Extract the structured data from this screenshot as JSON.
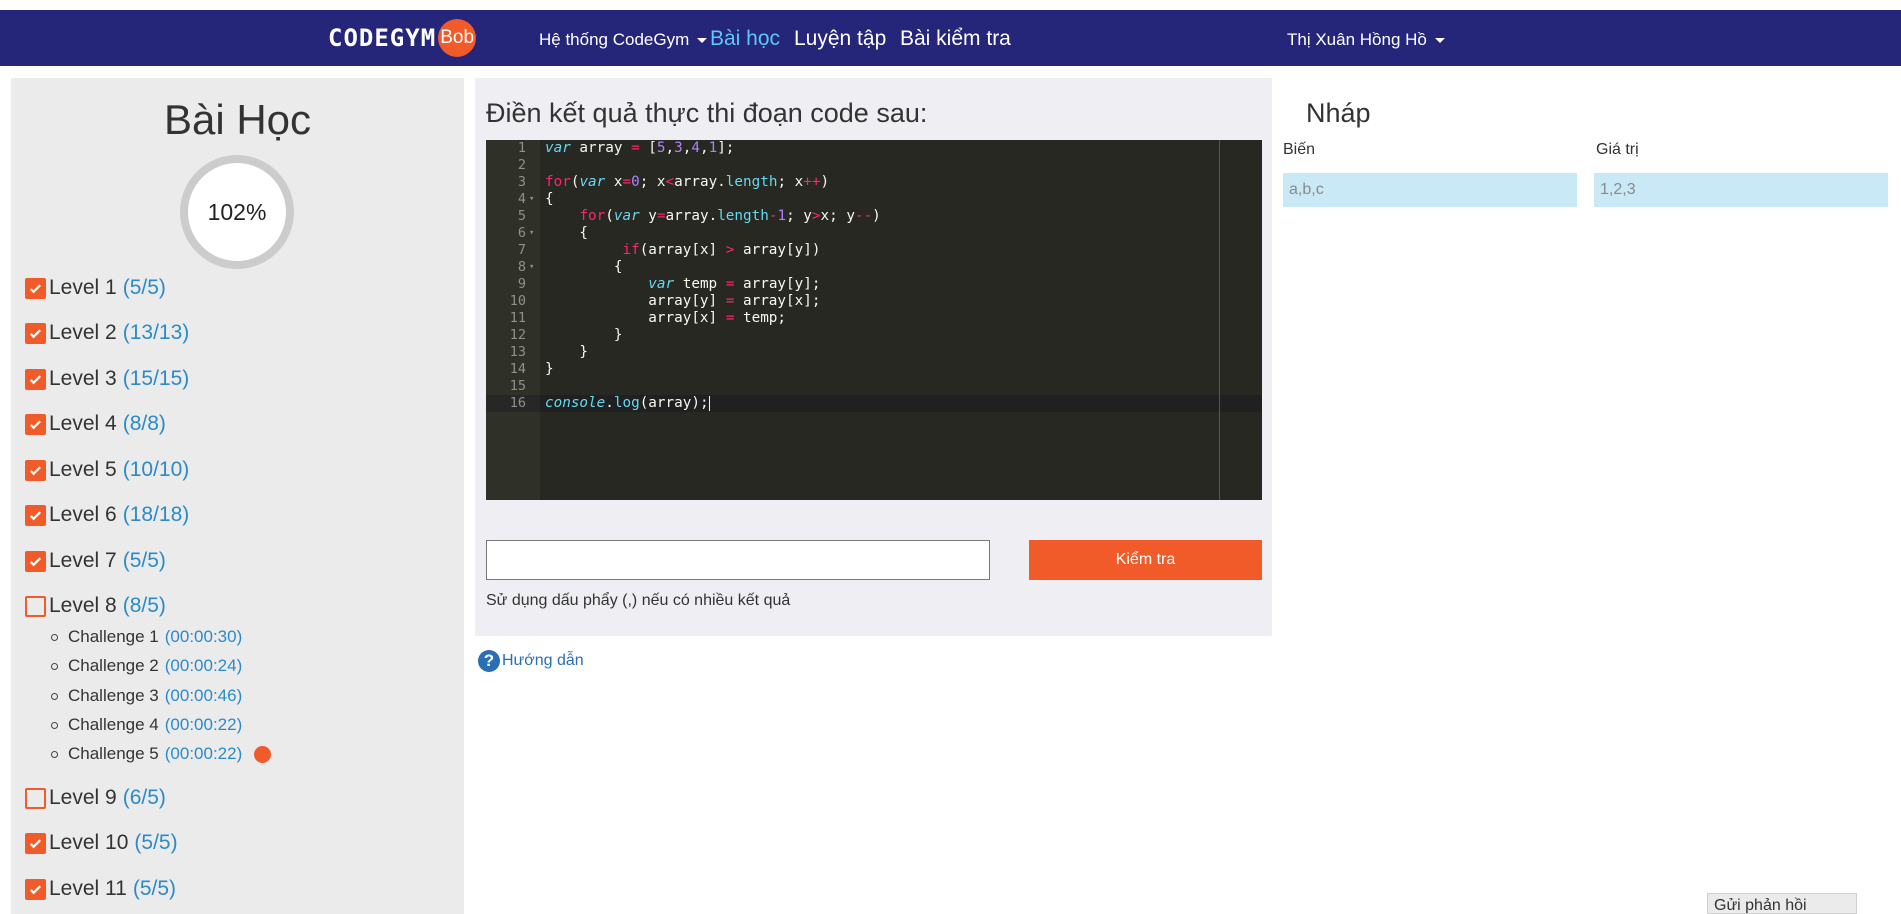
{
  "navbar": {
    "logo_text": "CODEGYM",
    "logo_badge": "Bob",
    "system_menu": "Hệ thống CodeGym",
    "lessons": "Bài học",
    "practice": "Luyện tập",
    "tests": "Bài kiểm tra",
    "user_name": "Thị Xuân Hồng Hồ",
    "active_color": "#5bc8f5",
    "bg_color": "#25257a"
  },
  "lessons_panel": {
    "title": "Bài Học",
    "progress": "102%",
    "levels": [
      {
        "label": "Level 1",
        "count": "(5/5)",
        "checked": true
      },
      {
        "label": "Level 2",
        "count": "(13/13)",
        "checked": true
      },
      {
        "label": "Level 3",
        "count": "(15/15)",
        "checked": true
      },
      {
        "label": "Level 4",
        "count": "(8/8)",
        "checked": true
      },
      {
        "label": "Level 5",
        "count": "(10/10)",
        "checked": true
      },
      {
        "label": "Level 6",
        "count": "(18/18)",
        "checked": true
      },
      {
        "label": "Level 7",
        "count": "(5/5)",
        "checked": true
      },
      {
        "label": "Level 8",
        "count": "(8/5)",
        "checked": false
      },
      {
        "label": "Level 9",
        "count": "(6/5)",
        "checked": false
      },
      {
        "label": "Level 10",
        "count": "(5/5)",
        "checked": true
      },
      {
        "label": "Level 11",
        "count": "(5/5)",
        "checked": true
      }
    ],
    "challenges": [
      {
        "label": "Challenge 1",
        "time": "(00:00:30)"
      },
      {
        "label": "Challenge 2",
        "time": "(00:00:24)"
      },
      {
        "label": "Challenge 3",
        "time": "(00:00:46)"
      },
      {
        "label": "Challenge 4",
        "time": "(00:00:22)"
      },
      {
        "label": "Challenge 5",
        "time": "(00:00:22)"
      }
    ],
    "accent_color": "#f15a29"
  },
  "exercise": {
    "title": "Điền kết quả thực thi đoạn code sau:",
    "code_line_numbers": [
      "1",
      "2",
      "3",
      "4",
      "5",
      "6",
      "7",
      "8",
      "9",
      "10",
      "11",
      "12",
      "13",
      "14",
      "15",
      "16"
    ],
    "answer_value": "",
    "check_button": "Kiểm tra",
    "hint": "Sử dụng dấu phẩy (,) nếu có nhiều kết quả",
    "guide_link": "Hướng dẫn",
    "guide_icon": "?"
  },
  "draft": {
    "title": "Nháp",
    "var_label": "Biến",
    "value_label": "Giá trị",
    "var_placeholder": "a,b,c",
    "value_placeholder": "1,2,3"
  },
  "feedback": "Gửi phản hồi"
}
